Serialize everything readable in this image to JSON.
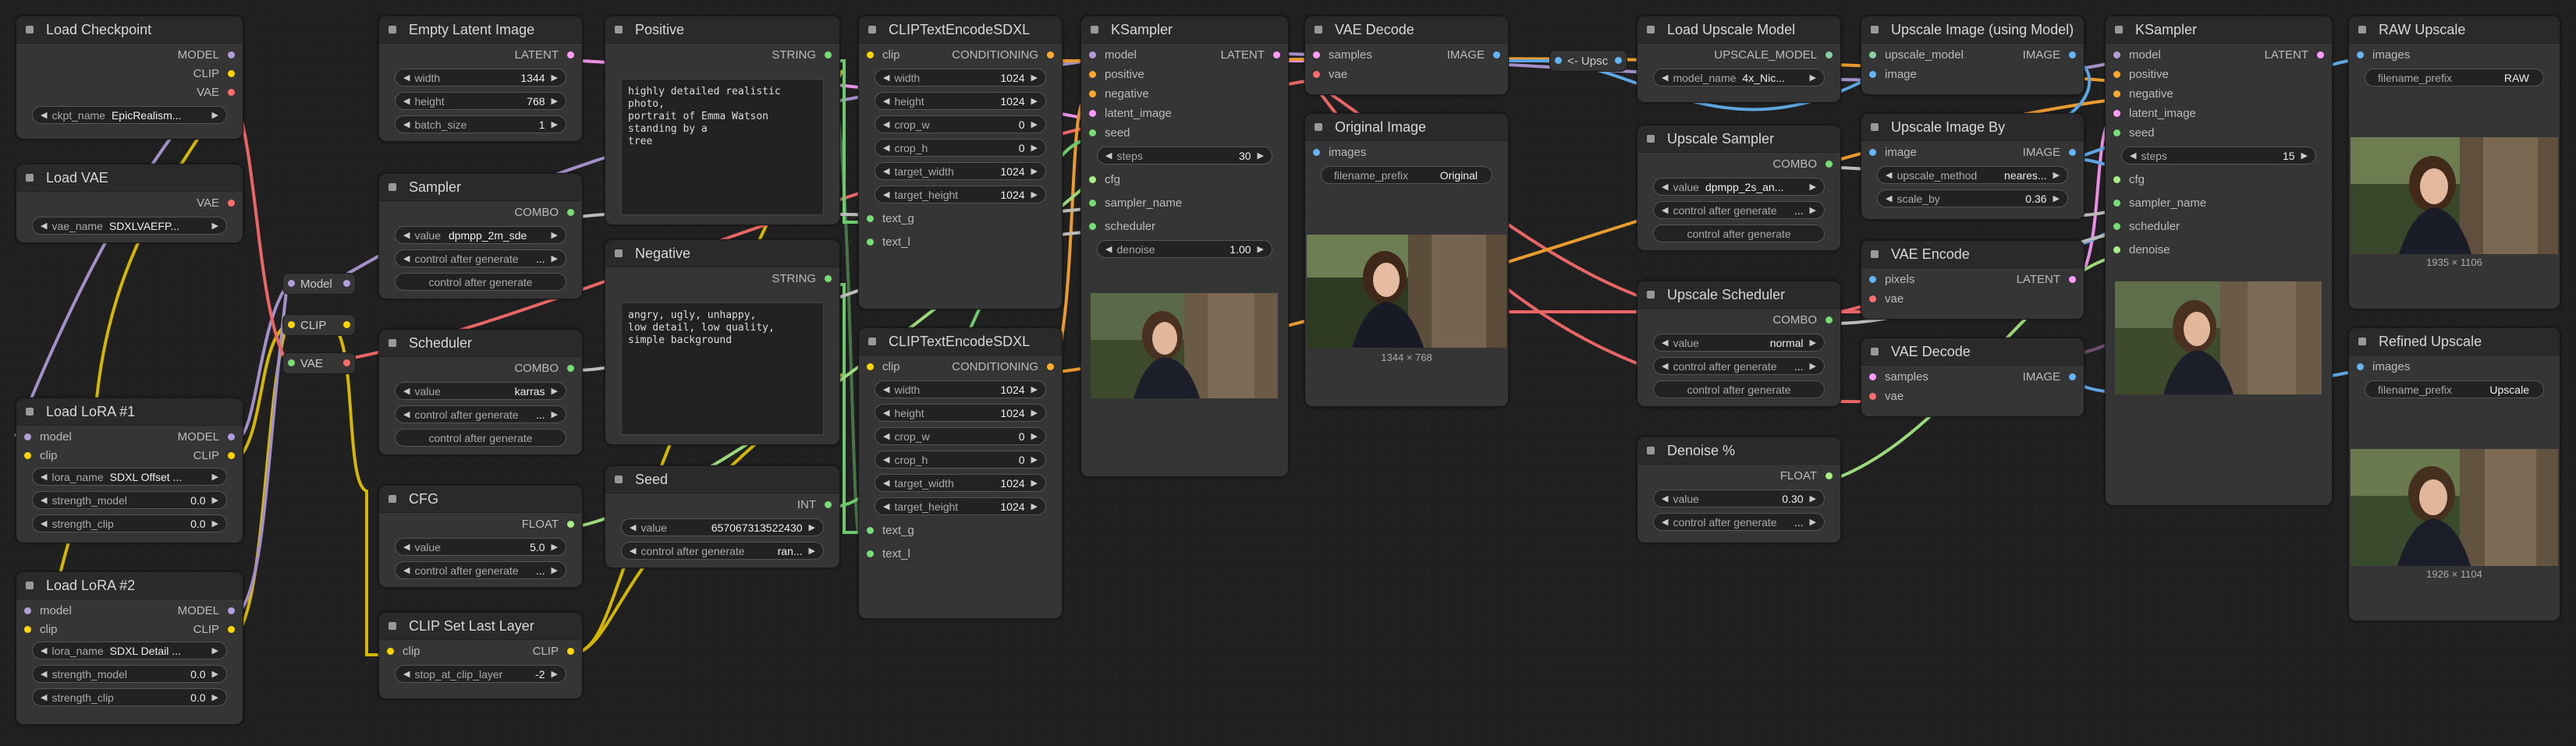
{
  "nodes": {
    "load_checkpoint": {
      "title": "Load Checkpoint",
      "out": [
        "MODEL",
        "CLIP",
        "VAE"
      ],
      "widget_name": "ckpt_name",
      "widget_value": "EpicRealism..."
    },
    "load_vae": {
      "title": "Load VAE",
      "out": "VAE",
      "widget_name": "vae_name",
      "widget_value": "SDXLVAEFP..."
    },
    "lora1": {
      "title": "Load LoRA #1",
      "in": [
        "model",
        "clip"
      ],
      "out": [
        "MODEL",
        "CLIP"
      ],
      "w": [
        [
          "lora_name",
          "SDXL Offset ..."
        ],
        [
          "strength_model",
          "0.0"
        ],
        [
          "strength_clip",
          "0.0"
        ]
      ]
    },
    "lora2": {
      "title": "Load LoRA #2",
      "in": [
        "model",
        "clip"
      ],
      "out": [
        "MODEL",
        "CLIP"
      ],
      "w": [
        [
          "lora_name",
          "SDXL Detail ..."
        ],
        [
          "strength_model",
          "0.0"
        ],
        [
          "strength_clip",
          "0.0"
        ]
      ]
    },
    "reroutes": {
      "model": "Model",
      "clip": "CLIP",
      "vae": "VAE",
      "upscale": "<- Upsc"
    },
    "empty_latent": {
      "title": "Empty Latent Image",
      "out": "LATENT",
      "w": [
        [
          "width",
          "1344"
        ],
        [
          "height",
          "768"
        ],
        [
          "batch_size",
          "1"
        ]
      ]
    },
    "sampler": {
      "title": "Sampler",
      "out": "COMBO",
      "w": [
        [
          "value",
          "dpmpp_2m_sde"
        ],
        [
          "control after generate",
          "..."
        ]
      ],
      "btn": "control after generate"
    },
    "scheduler": {
      "title": "Scheduler",
      "out": "COMBO",
      "w": [
        [
          "value",
          "karras"
        ],
        [
          "control after generate",
          "..."
        ]
      ],
      "btn": "control after generate"
    },
    "cfg": {
      "title": "CFG",
      "out": "FLOAT",
      "w": [
        [
          "value",
          "5.0"
        ],
        [
          "control after generate",
          "..."
        ]
      ]
    },
    "clip_set_last": {
      "title": "CLIP Set Last Layer",
      "in": "clip",
      "out": "CLIP",
      "w": [
        [
          "stop_at_clip_layer",
          "-2"
        ]
      ]
    },
    "positive": {
      "title": "Positive",
      "out": "STRING",
      "text": "highly detailed realistic photo,\nportrait of Emma Watson standing by a\ntree"
    },
    "negative": {
      "title": "Negative",
      "out": "STRING",
      "text": "angry, ugly, unhappy,\nlow detail, low quality,\nsimple background"
    },
    "seed": {
      "title": "Seed",
      "out": "INT",
      "w": [
        [
          "value",
          "657067313522430"
        ],
        [
          "control after generate",
          "ran..."
        ]
      ]
    },
    "clipenc1": {
      "title": "CLIPTextEncodeSDXL",
      "in": "clip",
      "out": "CONDITIONING",
      "w": [
        [
          "width",
          "1024"
        ],
        [
          "height",
          "1024"
        ],
        [
          "crop_w",
          "0"
        ],
        [
          "crop_h",
          "0"
        ],
        [
          "target_width",
          "1024"
        ],
        [
          "target_height",
          "1024"
        ]
      ],
      "in2": [
        "text_g",
        "text_l"
      ]
    },
    "clipenc2": {
      "title": "CLIPTextEncodeSDXL",
      "in": "clip",
      "out": "CONDITIONING",
      "w": [
        [
          "width",
          "1024"
        ],
        [
          "height",
          "1024"
        ],
        [
          "crop_w",
          "0"
        ],
        [
          "crop_h",
          "0"
        ],
        [
          "target_width",
          "1024"
        ],
        [
          "target_height",
          "1024"
        ]
      ],
      "in2": [
        "text_g",
        "text_l"
      ]
    },
    "ksampler1": {
      "title": "KSampler",
      "in": [
        "model",
        "positive",
        "negative",
        "latent_image",
        "seed"
      ],
      "out": "LATENT",
      "w1": [
        "steps",
        "30"
      ],
      "in2": [
        "cfg",
        "sampler_name",
        "scheduler"
      ],
      "w2": [
        "denoise",
        "1.00"
      ]
    },
    "vae_decode1": {
      "title": "VAE Decode",
      "in": [
        "samples",
        "vae"
      ],
      "out": "IMAGE"
    },
    "original_image": {
      "title": "Original Image",
      "in": "images",
      "w": [
        [
          "filename_prefix",
          "Original"
        ]
      ],
      "dim": "1344 × 768"
    },
    "load_upscale": {
      "title": "Load Upscale Model",
      "out": "UPSCALE_MODEL",
      "w": [
        [
          "model_name",
          "4x_Nic..."
        ]
      ]
    },
    "upscale_sampler": {
      "title": "Upscale Sampler",
      "out": "COMBO",
      "w": [
        [
          "value",
          "dpmpp_2s_an..."
        ],
        [
          "control after generate",
          "..."
        ]
      ],
      "btn": "control after generate"
    },
    "upscale_scheduler": {
      "title": "Upscale Scheduler",
      "out": "COMBO",
      "w": [
        [
          "value",
          "normal"
        ],
        [
          "control after generate",
          "..."
        ]
      ],
      "btn": "control after generate"
    },
    "denoise_pct": {
      "title": "Denoise %",
      "out": "FLOAT",
      "w": [
        [
          "value",
          "0.30"
        ],
        [
          "control after generate",
          "..."
        ]
      ]
    },
    "upscale_image_model": {
      "title": "Upscale Image (using Model)",
      "in": [
        "upscale_model",
        "image"
      ],
      "out": "IMAGE"
    },
    "upscale_image_by": {
      "title": "Upscale Image By",
      "in": "image",
      "out": "IMAGE",
      "w": [
        [
          "upscale_method",
          "neares..."
        ],
        [
          "scale_by",
          "0.36"
        ]
      ]
    },
    "vae_encode": {
      "title": "VAE Encode",
      "in": [
        "pixels",
        "vae"
      ],
      "out": "LATENT"
    },
    "vae_decode2": {
      "title": "VAE Decode",
      "in": [
        "samples",
        "vae"
      ],
      "out": "IMAGE"
    },
    "ksampler2": {
      "title": "KSampler",
      "in": [
        "model",
        "positive",
        "negative",
        "latent_image",
        "seed"
      ],
      "out": "LATENT",
      "w1": [
        "steps",
        "15"
      ],
      "in2": [
        "cfg",
        "sampler_name",
        "scheduler",
        "denoise"
      ]
    },
    "raw_upscale": {
      "title": "RAW Upscale",
      "in": "images",
      "w": [
        [
          "filename_prefix",
          "RAW"
        ]
      ],
      "dim": "1935 × 1106"
    },
    "refined_upscale": {
      "title": "Refined Upscale",
      "in": "images",
      "w": [
        [
          "filename_prefix",
          "Upscale"
        ]
      ],
      "dim": "1926 × 1104"
    }
  },
  "colors": {
    "model": "#b39ddb",
    "clip": "#ffd500",
    "vae": "#ff6e6e",
    "latent": "#ff9cf9",
    "conditioning": "#ffa931",
    "image": "#64b5f6",
    "string": "#77dd77",
    "int": "#77dd77",
    "float": "#aaee88",
    "combo": "#cccccc",
    "upscale": "#8bd0a0"
  }
}
